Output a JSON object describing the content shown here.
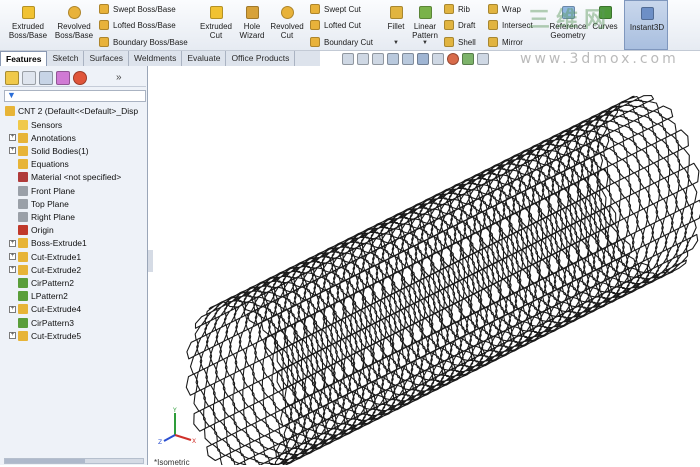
{
  "ribbon": {
    "buttons": [
      {
        "label": "Extruded\nBoss/Base",
        "icon": "extruded-boss-icon",
        "color": "#f1c232"
      },
      {
        "label": "Revolved\nBoss/Base",
        "icon": "revolved-boss-icon",
        "color": "#e8b23a"
      },
      {
        "label": "Extruded\nCut",
        "icon": "extruded-cut-icon",
        "color": "#f1c232"
      },
      {
        "label": "Hole\nWizard",
        "icon": "hole-wizard-icon",
        "color": "#d7a23a"
      },
      {
        "label": "Revolved\nCut",
        "icon": "revolved-cut-icon",
        "color": "#e8b23a"
      },
      {
        "label": "Fillet",
        "icon": "fillet-icon",
        "color": "#e1b440"
      },
      {
        "label": "Linear\nPattern",
        "icon": "linear-pattern-icon",
        "color": "#7ab24a"
      },
      {
        "label": "Reference\nGeometry",
        "icon": "reference-geometry-icon",
        "color": "#8fb6e0"
      },
      {
        "label": "Curves",
        "icon": "curves-icon",
        "color": "#4f9a3c"
      },
      {
        "label": "Instant3D",
        "icon": "instant3d-icon",
        "color": "#6d8fc6"
      }
    ],
    "small_buttons": [
      {
        "label": "Swept Boss/Base",
        "icon": "swept-boss-icon",
        "color": "#e8b23a"
      },
      {
        "label": "Lofted Boss/Base",
        "icon": "lofted-boss-icon",
        "color": "#e8b23a"
      },
      {
        "label": "Boundary Boss/Base",
        "icon": "boundary-boss-icon",
        "color": "#e8b23a"
      },
      {
        "label": "Swept Cut",
        "icon": "swept-cut-icon",
        "color": "#e8b23a"
      },
      {
        "label": "Lofted Cut",
        "icon": "lofted-cut-icon",
        "color": "#e8b23a"
      },
      {
        "label": "Boundary Cut",
        "icon": "boundary-cut-icon",
        "color": "#e8b23a"
      },
      {
        "label": "Rib",
        "icon": "rib-icon",
        "color": "#e1b440"
      },
      {
        "label": "Draft",
        "icon": "draft-icon",
        "color": "#e1b440"
      },
      {
        "label": "Shell",
        "icon": "shell-icon",
        "color": "#e1b440"
      },
      {
        "label": "Wrap",
        "icon": "wrap-icon",
        "color": "#e1b440"
      },
      {
        "label": "Intersect",
        "icon": "intersect-icon",
        "color": "#e1b440"
      },
      {
        "label": "Mirror",
        "icon": "mirror-icon",
        "color": "#e1b440"
      }
    ]
  },
  "watermark": {
    "text": "三维网",
    "url": "www.3dmox.com"
  },
  "tabs": [
    {
      "label": "Features",
      "active": true
    },
    {
      "label": "Sketch",
      "active": false
    },
    {
      "label": "Surfaces",
      "active": false
    },
    {
      "label": "Weldments",
      "active": false
    },
    {
      "label": "Evaluate",
      "active": false
    },
    {
      "label": "Office Products",
      "active": false
    }
  ],
  "view_toolbar": [
    "zoom-to-fit-icon",
    "zoom-area-icon",
    "previous-view-icon",
    "section-view-icon",
    "view-orientation-icon",
    "display-style-icon",
    "hide-show-icon",
    "edit-appearance-icon",
    "apply-scene-icon",
    "view-settings-icon"
  ],
  "feature_manager": {
    "tools": [
      "feature-manager-icon",
      "property-manager-icon",
      "configuration-manager-icon",
      "dimxpert-icon",
      "display-manager-icon"
    ],
    "expand_arrow": "»",
    "filter_icon": "filter-icon",
    "root": "CNT 2  (Default<<Default>_Disp",
    "items": [
      {
        "label": "Sensors",
        "icon": "sensors-icon",
        "expandable": false,
        "color": "#f0c94a"
      },
      {
        "label": "Annotations",
        "icon": "annotations-icon",
        "expandable": true,
        "color": "#e7b437"
      },
      {
        "label": "Solid Bodies(1)",
        "icon": "solid-bodies-icon",
        "expandable": true,
        "color": "#e7b437"
      },
      {
        "label": "Equations",
        "icon": "equations-icon",
        "expandable": false,
        "color": "#e7b437"
      },
      {
        "label": "Material <not specified>",
        "icon": "material-icon",
        "expandable": false,
        "color": "#b03b3b"
      },
      {
        "label": "Front Plane",
        "icon": "plane-icon",
        "expandable": false,
        "color": "#9aa0a8"
      },
      {
        "label": "Top Plane",
        "icon": "plane-icon",
        "expandable": false,
        "color": "#9aa0a8"
      },
      {
        "label": "Right Plane",
        "icon": "plane-icon",
        "expandable": false,
        "color": "#9aa0a8"
      },
      {
        "label": "Origin",
        "icon": "origin-icon",
        "expandable": false,
        "color": "#c0392b"
      },
      {
        "label": "Boss-Extrude1",
        "icon": "boss-extrude-icon",
        "expandable": true,
        "color": "#e7b437"
      },
      {
        "label": "Cut-Extrude1",
        "icon": "cut-extrude-icon",
        "expandable": true,
        "color": "#e7b437"
      },
      {
        "label": "Cut-Extrude2",
        "icon": "cut-extrude-icon",
        "expandable": true,
        "color": "#e7b437"
      },
      {
        "label": "CirPattern2",
        "icon": "circular-pattern-icon",
        "expandable": false,
        "color": "#5a9e3a"
      },
      {
        "label": "LPattern2",
        "icon": "linear-pattern-icon",
        "expandable": false,
        "color": "#5a9e3a"
      },
      {
        "label": "Cut-Extrude4",
        "icon": "cut-extrude-icon",
        "expandable": true,
        "color": "#e7b437"
      },
      {
        "label": "CirPattern3",
        "icon": "circular-pattern-icon",
        "expandable": false,
        "color": "#5a9e3a"
      },
      {
        "label": "Cut-Extrude5",
        "icon": "cut-extrude-icon",
        "expandable": true,
        "color": "#e7b437"
      }
    ]
  },
  "viewport": {
    "model": "carbon nanotube hexagonal lattice",
    "line_color": "#1a1a1a"
  },
  "triad": {
    "x_label": "X",
    "y_label": "Y",
    "z_label": "Z"
  },
  "status": {
    "bottom_text": "*Isometric"
  }
}
